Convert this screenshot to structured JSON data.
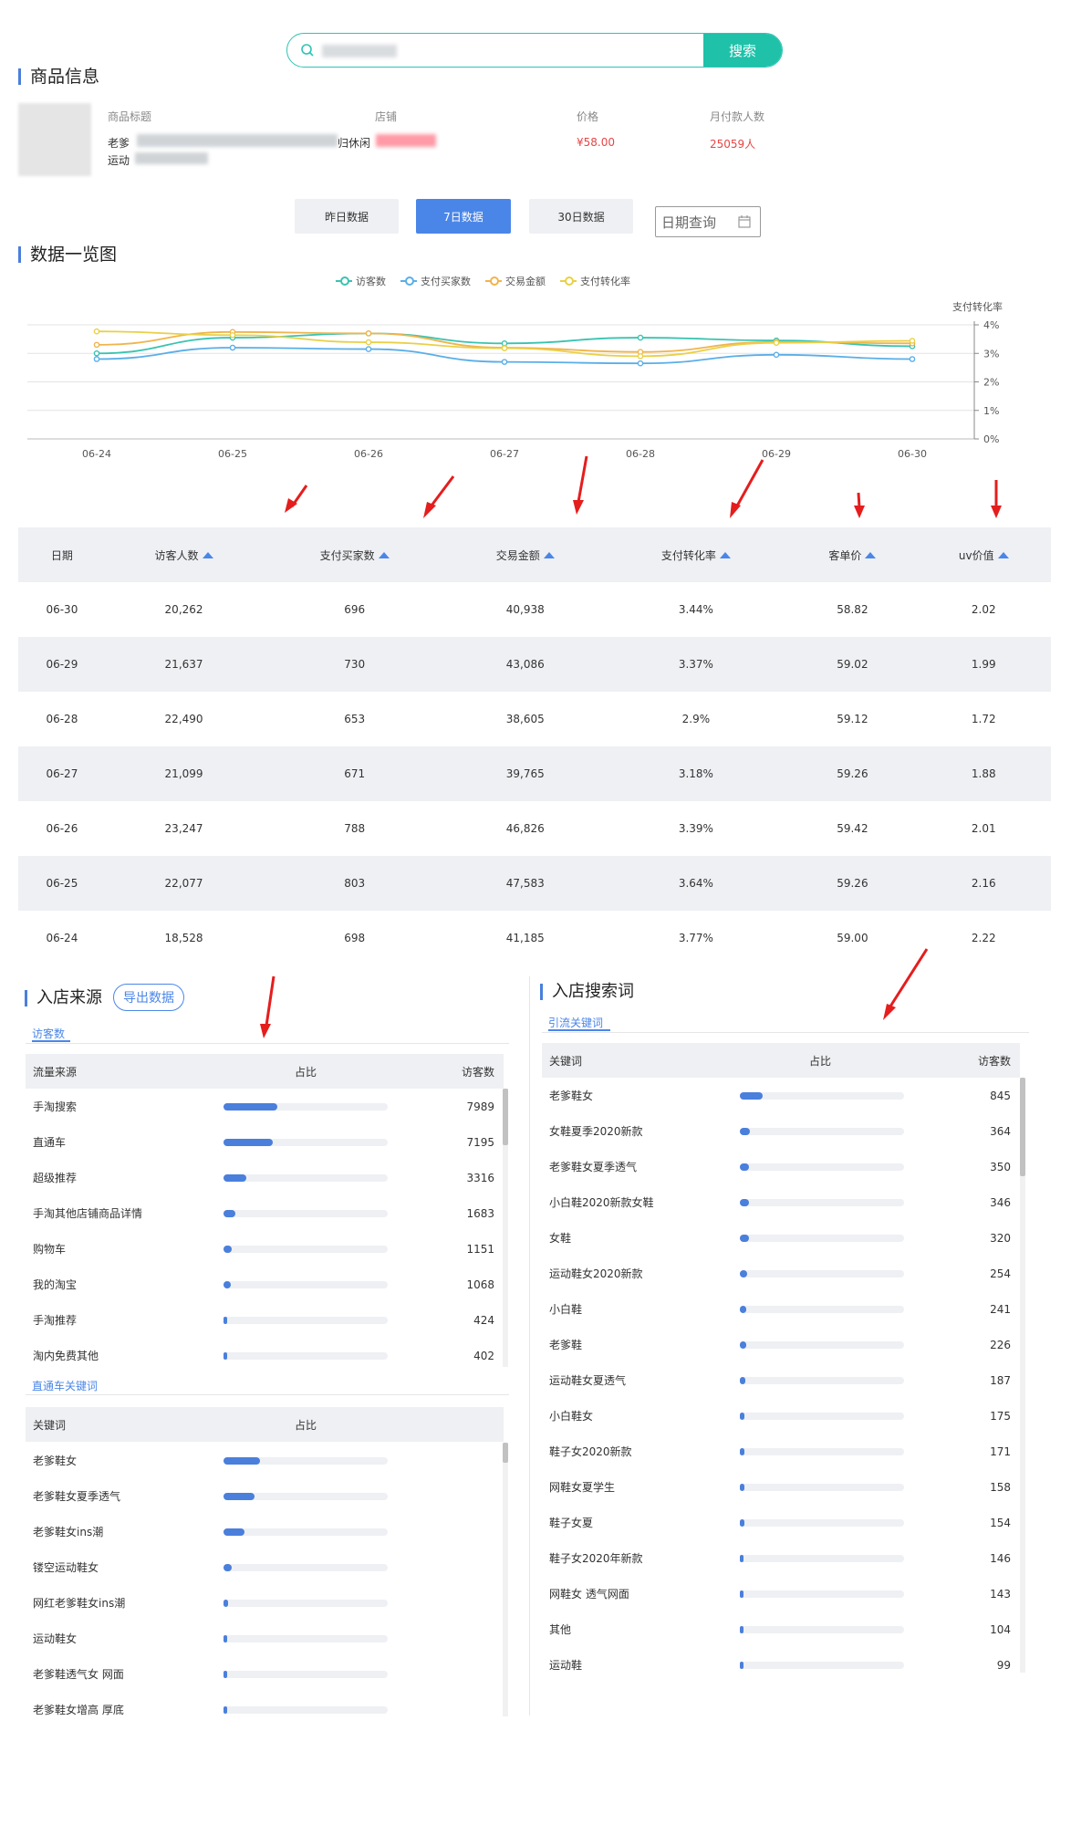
{
  "search": {
    "placeholder": "",
    "button": "搜索"
  },
  "product": {
    "section_title": "商品信息",
    "headers": {
      "title": "商品标题",
      "shop": "店铺",
      "price": "价格",
      "monthly": "月付款人数"
    },
    "title_line1": "老爹",
    "title_line2": "运动",
    "shop_fragment": "归休闲",
    "price": "¥58.00",
    "monthly_buyers": "25059人"
  },
  "tabs": [
    "昨日数据",
    "7日数据",
    "30日数据"
  ],
  "active_tab": 1,
  "date_query": "日期查询",
  "overview_title": "数据一览图",
  "chart_data": {
    "type": "line",
    "categories": [
      "06-24",
      "06-25",
      "06-26",
      "06-27",
      "06-28",
      "06-29",
      "06-30"
    ],
    "legend_position": "top-center",
    "right_axis_label": "支付转化率",
    "right_axis_ticks": [
      "0%",
      "1%",
      "2%",
      "3%",
      "4%"
    ],
    "grid": true,
    "series": [
      {
        "name": "访客数",
        "color": "#3ac3b0",
        "values": [
          3.0,
          3.55,
          3.7,
          3.35,
          3.55,
          3.45,
          3.25
        ]
      },
      {
        "name": "支付买家数",
        "color": "#5aaee8",
        "values": [
          2.8,
          3.2,
          3.15,
          2.7,
          2.65,
          2.95,
          2.8
        ]
      },
      {
        "name": "交易金额",
        "color": "#f0b44c",
        "values": [
          3.3,
          3.75,
          3.7,
          3.2,
          3.05,
          3.4,
          3.35
        ]
      },
      {
        "name": "支付转化率",
        "color": "#e9d046",
        "values": [
          3.77,
          3.64,
          3.39,
          3.18,
          2.9,
          3.37,
          3.44
        ]
      }
    ]
  },
  "table": {
    "headers": [
      "日期",
      "访客人数",
      "支付买家数",
      "交易金额",
      "支付转化率",
      "客单价",
      "uv价值"
    ],
    "rows": [
      [
        "06-30",
        "20,262",
        "696",
        "40,938",
        "3.44%",
        "58.82",
        "2.02"
      ],
      [
        "06-29",
        "21,637",
        "730",
        "43,086",
        "3.37%",
        "59.02",
        "1.99"
      ],
      [
        "06-28",
        "22,490",
        "653",
        "38,605",
        "2.9%",
        "59.12",
        "1.72"
      ],
      [
        "06-27",
        "21,099",
        "671",
        "39,765",
        "3.18%",
        "59.26",
        "1.88"
      ],
      [
        "06-26",
        "23,247",
        "788",
        "46,826",
        "3.39%",
        "59.42",
        "2.01"
      ],
      [
        "06-25",
        "22,077",
        "803",
        "47,583",
        "3.64%",
        "59.26",
        "2.16"
      ],
      [
        "06-24",
        "18,528",
        "698",
        "41,185",
        "3.77%",
        "59.00",
        "2.22"
      ]
    ]
  },
  "traffic": {
    "title": "入店来源",
    "export": "导出数据",
    "sub_tab": "访客数",
    "headers": [
      "流量来源",
      "占比",
      "访客数"
    ],
    "rows": [
      {
        "name": "手淘搜索",
        "value": "7989",
        "pct": 0.33
      },
      {
        "name": "直通车",
        "value": "7195",
        "pct": 0.3
      },
      {
        "name": "超级推荐",
        "value": "3316",
        "pct": 0.14
      },
      {
        "name": "手淘其他店铺商品详情",
        "value": "1683",
        "pct": 0.07
      },
      {
        "name": "购物车",
        "value": "1151",
        "pct": 0.05
      },
      {
        "name": "我的淘宝",
        "value": "1068",
        "pct": 0.045
      },
      {
        "name": "手淘推荐",
        "value": "424",
        "pct": 0.018
      },
      {
        "name": "淘内免费其他",
        "value": "402",
        "pct": 0.017
      }
    ],
    "kw_tab": "直通车关键词",
    "kw_headers": [
      "关键词",
      "占比"
    ],
    "kw_rows": [
      {
        "name": "老爹鞋女",
        "pct": 0.22
      },
      {
        "name": "老爹鞋女夏季透气",
        "pct": 0.19
      },
      {
        "name": "老爹鞋女ins潮",
        "pct": 0.13
      },
      {
        "name": "镂空运动鞋女",
        "pct": 0.05
      },
      {
        "name": "网红老爹鞋女ins潮",
        "pct": 0.03
      },
      {
        "name": "运动鞋女",
        "pct": 0.015
      },
      {
        "name": "老爹鞋透气女 网面",
        "pct": 0.015
      },
      {
        "name": "老爹鞋女增高 厚底",
        "pct": 0.015
      }
    ]
  },
  "search_terms": {
    "title": "入店搜索词",
    "sub_tab": "引流关键词",
    "headers": [
      "关键词",
      "占比",
      "访客数"
    ],
    "rows": [
      {
        "name": "老爹鞋女",
        "value": "845",
        "pct": 0.14
      },
      {
        "name": "女鞋夏季2020新款",
        "value": "364",
        "pct": 0.06
      },
      {
        "name": "老爹鞋女夏季透气",
        "value": "350",
        "pct": 0.058
      },
      {
        "name": "小白鞋2020新款女鞋",
        "value": "346",
        "pct": 0.057
      },
      {
        "name": "女鞋",
        "value": "320",
        "pct": 0.053
      },
      {
        "name": "运动鞋女2020新款",
        "value": "254",
        "pct": 0.042
      },
      {
        "name": "小白鞋",
        "value": "241",
        "pct": 0.04
      },
      {
        "name": "老爹鞋",
        "value": "226",
        "pct": 0.037
      },
      {
        "name": "运动鞋女夏透气",
        "value": "187",
        "pct": 0.031
      },
      {
        "name": "小白鞋女",
        "value": "175",
        "pct": 0.029
      },
      {
        "name": "鞋子女2020新款",
        "value": "171",
        "pct": 0.028
      },
      {
        "name": "网鞋女夏学生",
        "value": "158",
        "pct": 0.026
      },
      {
        "name": "鞋子女夏",
        "value": "154",
        "pct": 0.025
      },
      {
        "name": "鞋子女2020年新款",
        "value": "146",
        "pct": 0.024
      },
      {
        "name": "网鞋女 透气网面",
        "value": "143",
        "pct": 0.023
      },
      {
        "name": "其他",
        "value": "104",
        "pct": 0.017
      },
      {
        "name": "运动鞋",
        "value": "99",
        "pct": 0.016
      }
    ]
  }
}
